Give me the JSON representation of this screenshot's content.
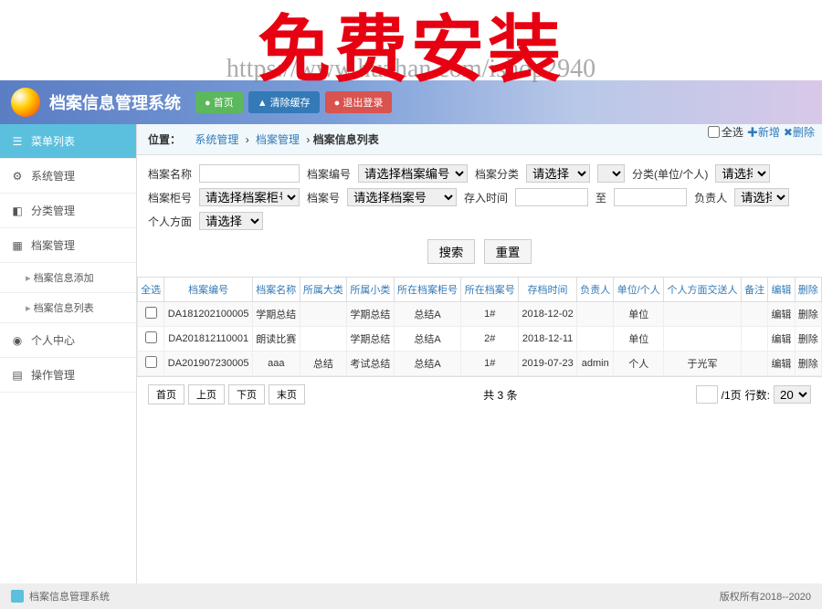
{
  "watermark": {
    "title": "免费安装",
    "url": "https://www.huzhan.com/ishop2940"
  },
  "header": {
    "app_title": "档案信息管理系统",
    "btn_home": "首页",
    "btn_clear": "清除缓存",
    "btn_logout": "退出登录"
  },
  "sidebar": {
    "menu_list": "菜单列表",
    "system": "系统管理",
    "category": "分类管理",
    "archive": "档案管理",
    "archive_add": "档案信息添加",
    "archive_list": "档案信息列表",
    "personal": "个人中心",
    "operation": "操作管理"
  },
  "breadcrumb": {
    "label": "位置：",
    "lv1": "系统管理",
    "lv2": "档案管理",
    "lv3": "档案信息列表"
  },
  "search": {
    "name_lbl": "档案名称",
    "code_lbl": "档案编号",
    "code_ph": "请选择档案编号",
    "cat_lbl": "档案分类",
    "cat_ph": "请选择",
    "catunit_lbl": "分类(单位/个人)",
    "catunit_ph": "请选择",
    "cab_lbl": "档案柜号",
    "cab_ph": "请选择档案柜号",
    "room_lbl": "档案号",
    "room_ph": "请选择档案号",
    "time_lbl": "存入时间",
    "to": "至",
    "person_lbl": "负责人",
    "person_ph": "请选择",
    "aspect_lbl": "个人方面",
    "aspect_ph": "请选择",
    "btn_search": "搜索",
    "btn_reset": "重置",
    "all_label": "全选",
    "add_label": "新增",
    "del_label": "删除"
  },
  "table": {
    "sel_all": "全选",
    "cols": [
      "档案编号",
      "档案名称",
      "所属大类",
      "所属小类",
      "所在档案柜号",
      "所在档案号",
      "存档时间",
      "负责人",
      "单位/个人",
      "个人方面交送人",
      "备注",
      "编辑",
      "删除"
    ],
    "rows": [
      {
        "code": "DA181202100005",
        "name": "学期总结",
        "cat1": "",
        "cat2": "学期总结",
        "cab": "总结A",
        "room": "1#",
        "time": "2018-12-02",
        "person": "",
        "unit": "单位",
        "unitcls": "green-txt",
        "sender": "",
        "note": "",
        "edit": "编辑",
        "del": "删除"
      },
      {
        "code": "DA201812110001",
        "name": "朗读比赛",
        "cat1": "",
        "cat2": "学期总结",
        "cab": "总结A",
        "room": "2#",
        "time": "2018-12-11",
        "person": "",
        "unit": "单位",
        "unitcls": "green-txt",
        "sender": "",
        "note": "",
        "edit": "编辑",
        "del": "删除"
      },
      {
        "code": "DA201907230005",
        "name": "aaa",
        "cat1": "总结",
        "cat2": "考试总结",
        "cab": "总结A",
        "room": "1#",
        "time": "2019-07-23",
        "person": "admin",
        "unit": "个人",
        "unitcls": "red-txt",
        "sender": "于光军",
        "note": "",
        "edit": "编辑",
        "del": "删除"
      }
    ]
  },
  "pager": {
    "first": "首页",
    "prev": "上页",
    "next": "下页",
    "last": "末页",
    "total": "共 3 条",
    "per": "/1页",
    "rows_lbl": "行数:",
    "rows_val": "20"
  },
  "footer": {
    "title": "档案信息管理系统",
    "copyright": "版权所有2018--2020"
  }
}
